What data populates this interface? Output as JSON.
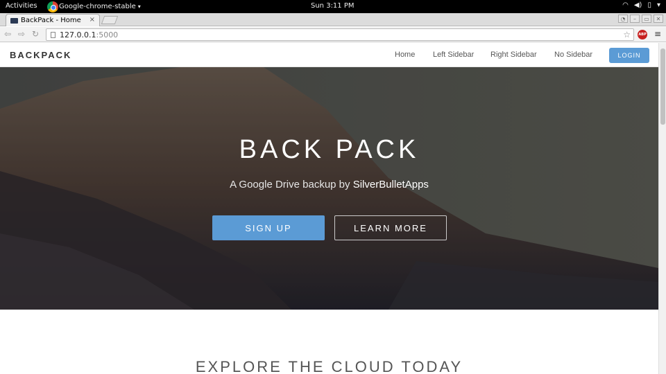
{
  "os_topbar": {
    "activities": "Activities",
    "app_name": "Google-chrome-stable",
    "app_caret": "▾",
    "clock": "Sun  3:11 PM"
  },
  "browser": {
    "tab_title": "BackPack - Home",
    "tab_close": "×",
    "url_host": "127.0.0.1",
    "url_port": ":5000",
    "abp_label": "ABP"
  },
  "site": {
    "brand": "BACKPACK",
    "nav": [
      "Home",
      "Left Sidebar",
      "Right Sidebar",
      "No Sidebar"
    ],
    "login_label": "LOGIN",
    "accent_color": "#5b9bd5"
  },
  "hero": {
    "title": "BACK PACK",
    "subtitle_prefix": "A Google Drive backup by ",
    "subtitle_brand": "SilverBulletApps",
    "signup_label": "SIGN UP",
    "learn_more_label": "LEARN MORE"
  },
  "section": {
    "title": "EXPLORE THE CLOUD TODAY"
  }
}
